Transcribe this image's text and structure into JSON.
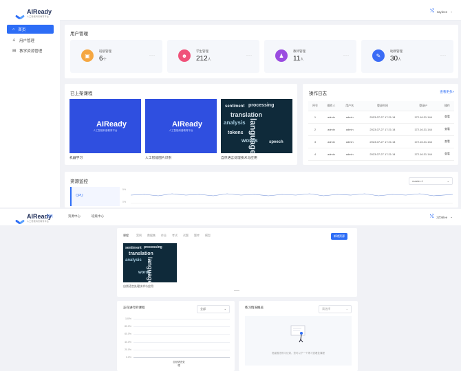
{
  "brand": {
    "name": "AIReady",
    "sub": "人工智能科普教育平台"
  },
  "admin": {
    "user": "zayleen",
    "sidebar": [
      {
        "label": "首页",
        "icon": "home-icon",
        "active": true
      },
      {
        "label": "用户管理",
        "icon": "user-icon",
        "active": false
      },
      {
        "label": "教学资源管理",
        "icon": "book-icon",
        "active": false
      }
    ],
    "user_mgmt": {
      "title": "用户管理",
      "stats": [
        {
          "label": "班级管理",
          "value": "6",
          "unit": "个",
          "color": "#f5a742",
          "icon": "class-icon"
        },
        {
          "label": "学生管理",
          "value": "212",
          "unit": "人",
          "color": "#f0527a",
          "icon": "student-icon"
        },
        {
          "label": "教师管理",
          "value": "11",
          "unit": "人",
          "color": "#9a4ce0",
          "icon": "teacher-icon"
        },
        {
          "label": "助教管理",
          "value": "30",
          "unit": "人",
          "color": "#3b6cf6",
          "icon": "assistant-icon"
        }
      ],
      "more": "···"
    },
    "courses": {
      "title": "已上架课程",
      "items": [
        {
          "name": "机器学习",
          "tag": "人工智能科普教育平台"
        },
        {
          "name": "人工智能图片识别",
          "tag": "人工智能科普教育平台"
        },
        {
          "name": "自然语言处理技术与应用"
        }
      ]
    },
    "logs": {
      "title": "操作日志",
      "more": "查看更多>",
      "headers": [
        "序号",
        "操作人",
        "用户名",
        "登录时间",
        "登录IP",
        "操作"
      ],
      "rows": [
        [
          "1",
          "admin",
          "admin",
          "2023-07-27 17:21:14",
          "172.16.31.144",
          "查看"
        ],
        [
          "2",
          "admin",
          "admin",
          "2023-07-27 17:21:14",
          "172.16.31.144",
          "查看"
        ],
        [
          "3",
          "admin",
          "admin",
          "2023-07-27 17:21:14",
          "172.16.31.144",
          "查看"
        ],
        [
          "4",
          "admin",
          "admin",
          "2023-07-27 17:21:14",
          "172.16.31.144",
          "查看"
        ]
      ]
    },
    "monitor": {
      "title": "资源监控",
      "select": "master-1",
      "metric": "CPU",
      "ticks": [
        "5%",
        "0%"
      ]
    }
  },
  "teacher": {
    "nav": [
      "首页",
      "资源中心",
      "班级中心"
    ],
    "user": "zZ06lee",
    "tabs": [
      "课程",
      "案例",
      "数据集",
      "作业",
      "考试",
      "试题",
      "题库",
      "模型"
    ],
    "upload_btn": "新增资源",
    "course": {
      "name": "自然语言处理技术与应用"
    },
    "progress": {
      "title": "正在进行的课程",
      "select": "全部",
      "yticks": [
        "100%",
        "80.0%",
        "60.0%",
        "40.0%",
        "20.0%",
        "0.0%"
      ],
      "xlabel": "自然语言处理"
    },
    "practice": {
      "title": "练习情况概览",
      "select": "请选择",
      "empty": "班级暂无练习记录，您可以下一个练习查看此课程"
    }
  },
  "chart_data": {
    "type": "bar",
    "categories": [
      "自然语言处理"
    ],
    "values": [
      0
    ],
    "ylim": [
      0,
      100
    ],
    "yticks": [
      "100%",
      "80.0%",
      "60.0%",
      "40.0%",
      "20.0%",
      "0.0%"
    ]
  }
}
